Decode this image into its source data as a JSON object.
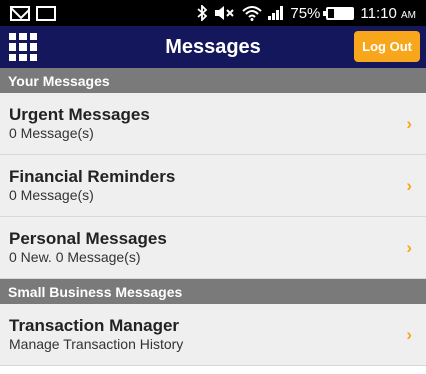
{
  "status_bar": {
    "battery": "75%",
    "battery_level": 0.75,
    "time": "11:10",
    "ampm": "AM",
    "icons": [
      "gmail-icon",
      "message-icon",
      "bluetooth-icon",
      "mute-icon",
      "wifi-icon",
      "signal-icon",
      "battery-icon"
    ]
  },
  "header": {
    "title": "Messages",
    "logout_label": "Log Out",
    "menu_icon": "grid-menu-icon"
  },
  "sections": [
    {
      "title": "Your Messages",
      "items": [
        {
          "title": "Urgent Messages",
          "subtitle": "0 Message(s)"
        },
        {
          "title": "Financial Reminders",
          "subtitle": "0 Message(s)"
        },
        {
          "title": "Personal Messages",
          "subtitle": "0 New. 0 Message(s)"
        }
      ]
    },
    {
      "title": "Small Business Messages",
      "items": [
        {
          "title": "Transaction Manager",
          "subtitle": "Manage Transaction History"
        }
      ]
    }
  ],
  "chevron": "›",
  "colors": {
    "header_bg": "#15175c",
    "accent": "#f8a61b",
    "section_bg": "#7a7a7a",
    "item_bg": "#efefef"
  }
}
